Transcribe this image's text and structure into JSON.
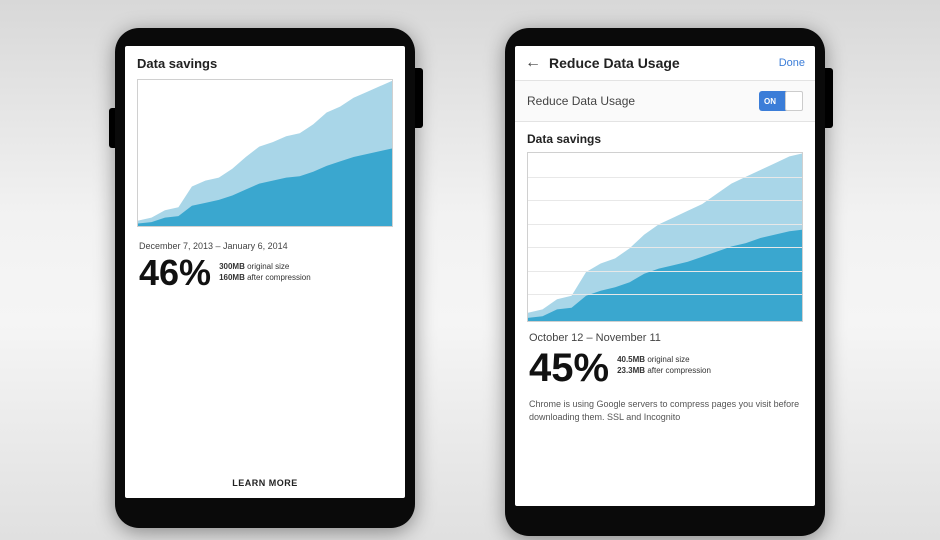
{
  "left": {
    "header": "Data savings",
    "date_range": "December 7, 2013 – January 6, 2014",
    "percent": "46%",
    "original_val": "300MB",
    "original_label": "original size",
    "after_val": "160MB",
    "after_label": "after compression",
    "learn_more": "LEARN MORE"
  },
  "right": {
    "back": "←",
    "title": "Reduce Data Usage",
    "done": "Done",
    "toggle_label": "Reduce Data Usage",
    "toggle_on": "ON",
    "section": "Data savings",
    "date_range": "October 12 – November 11",
    "percent": "45%",
    "original_val": "40.5MB",
    "original_label": "original size",
    "after_val": "23.3MB",
    "after_label": "after compression",
    "description": "Chrome is using Google servers to compress pages you visit before downloading them. SSL and Incognito"
  },
  "chart_data": [
    {
      "type": "area",
      "title": "Data savings",
      "xlabel": "",
      "ylabel": "",
      "x": [
        0,
        1,
        2,
        3,
        4,
        5,
        6,
        7,
        8,
        9,
        10,
        11,
        12,
        13,
        14,
        15,
        16,
        17,
        18,
        19
      ],
      "series": [
        {
          "name": "original size",
          "values": [
            5,
            7,
            12,
            14,
            28,
            32,
            34,
            40,
            48,
            55,
            58,
            62,
            64,
            70,
            78,
            82,
            88,
            92,
            96,
            100
          ]
        },
        {
          "name": "after compression",
          "values": [
            3,
            4,
            7,
            8,
            15,
            17,
            19,
            22,
            26,
            30,
            32,
            34,
            35,
            38,
            42,
            45,
            48,
            50,
            52,
            54
          ]
        }
      ],
      "ylim": [
        0,
        100
      ],
      "colors": {
        "original": "#a9d6e8",
        "after": "#3aa7cf"
      }
    },
    {
      "type": "area",
      "title": "Data savings",
      "xlabel": "",
      "ylabel": "",
      "x": [
        0,
        1,
        2,
        3,
        4,
        5,
        6,
        7,
        8,
        9,
        10,
        11,
        12,
        13,
        14,
        15,
        16,
        17,
        18,
        19
      ],
      "series": [
        {
          "name": "original size",
          "values": [
            6,
            8,
            14,
            16,
            30,
            35,
            38,
            44,
            52,
            58,
            62,
            66,
            70,
            76,
            82,
            86,
            90,
            94,
            98,
            100
          ]
        },
        {
          "name": "after compression",
          "values": [
            3,
            4,
            8,
            9,
            16,
            19,
            21,
            24,
            29,
            32,
            34,
            36,
            39,
            42,
            45,
            47,
            50,
            52,
            54,
            55
          ]
        }
      ],
      "ylim": [
        0,
        100
      ],
      "colors": {
        "original": "#a9d6e8",
        "after": "#3aa7cf"
      }
    }
  ]
}
